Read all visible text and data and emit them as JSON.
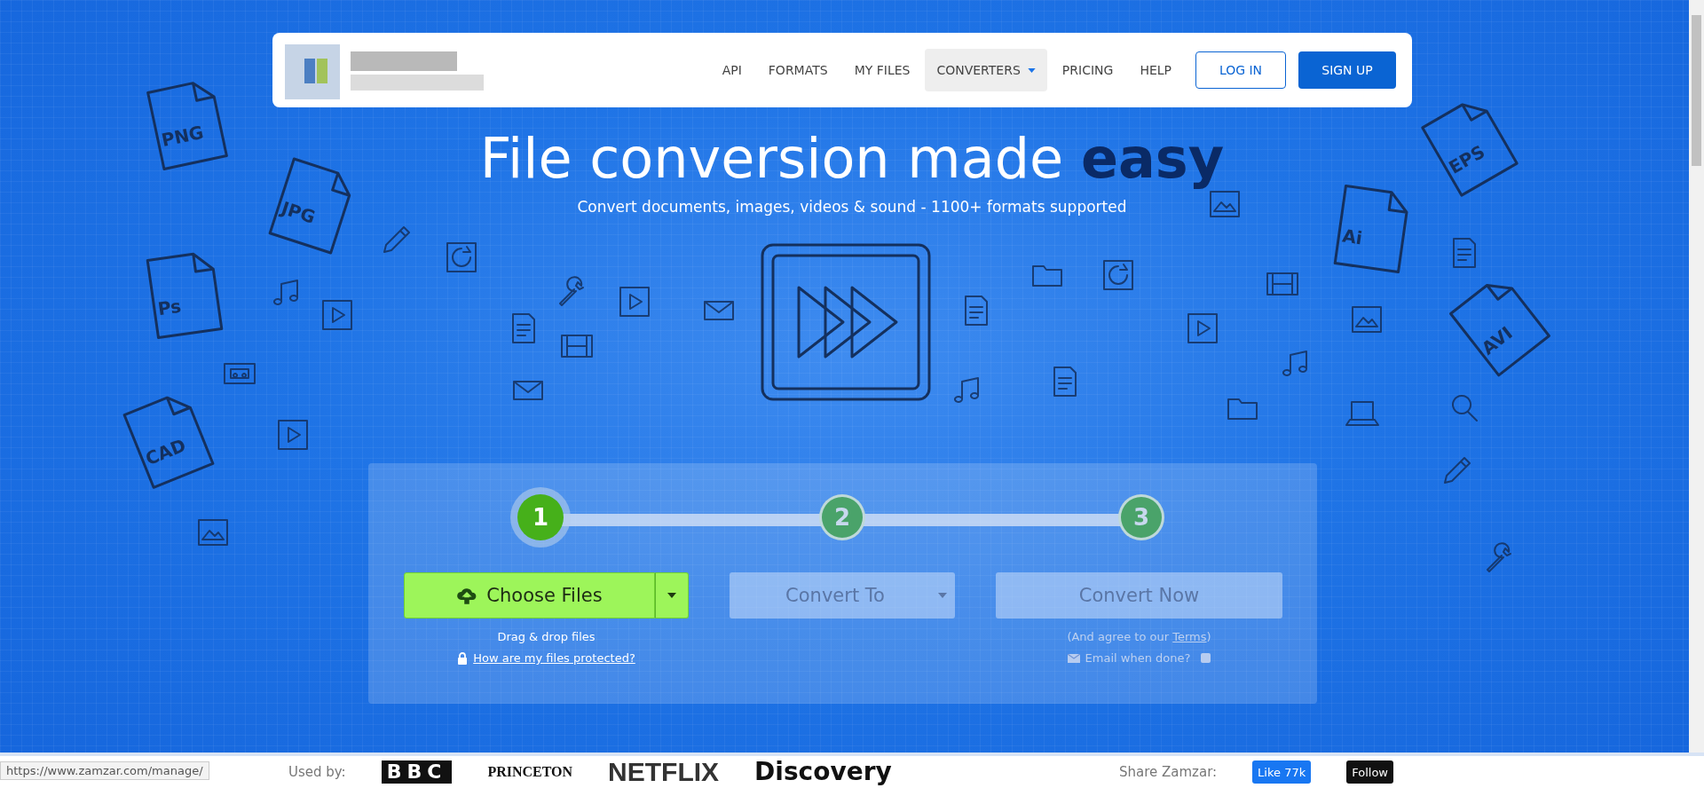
{
  "nav": {
    "links": [
      {
        "label": "API",
        "selected": false,
        "dropdown": false
      },
      {
        "label": "FORMATS",
        "selected": false,
        "dropdown": false
      },
      {
        "label": "MY FILES",
        "selected": false,
        "dropdown": false
      },
      {
        "label": "CONVERTERS",
        "selected": true,
        "dropdown": true
      },
      {
        "label": "PRICING",
        "selected": false,
        "dropdown": false
      },
      {
        "label": "HELP",
        "selected": false,
        "dropdown": false
      }
    ],
    "login": "LOG IN",
    "signup": "SIGN UP"
  },
  "hero": {
    "title": "File conversion made ",
    "title_bold": "easy",
    "subtitle": "Convert documents, images, videos & sound - 1100+ formats supported"
  },
  "doodles": [
    {
      "label": "PNG"
    },
    {
      "label": "JPG"
    },
    {
      "label": "Ps"
    },
    {
      "label": "CAD"
    },
    {
      "label": "EPS"
    },
    {
      "label": "Ai"
    },
    {
      "label": "AVI"
    }
  ],
  "steps": [
    {
      "number": "1",
      "selected": true
    },
    {
      "number": "2",
      "selected": false
    },
    {
      "number": "3",
      "selected": false
    }
  ],
  "choose": {
    "label": "Choose Files",
    "hint": "Drag & drop files",
    "protect_link": "How are my files protected?"
  },
  "convert_to": {
    "label": "Convert To",
    "disabled": true
  },
  "convert_now": {
    "label": "Convert Now",
    "disabled": true,
    "agree_prefix": "(And agree to our ",
    "terms": "Terms",
    "agree_suffix": ")",
    "email_label": "Email when done?",
    "email_checked": false
  },
  "footer": {
    "used_by": "Used by:",
    "logos": [
      "BBC",
      "PRINCETON",
      "NETFLIX",
      "Discovery"
    ],
    "share": "Share Zamzar:",
    "like": "Like 77k",
    "follow": "Follow"
  },
  "status_url": "https://www.zamzar.com/manage/"
}
